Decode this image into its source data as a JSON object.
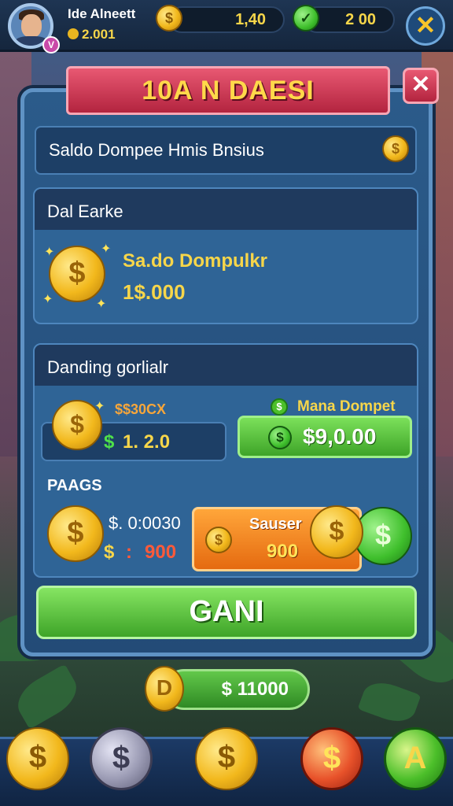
{
  "topbar": {
    "player_name": "Ide Alneett",
    "player_balance": "2.001",
    "currency_1_value": "1,40",
    "currency_2_value": "2 00",
    "currency_1_icon": "$",
    "currency_2_icon": "✓",
    "avatar_badge": "V",
    "close_glyph": "✕"
  },
  "dialog": {
    "title": "10A N DAESI",
    "close_glyph": "✕",
    "header_bar_text": "Saldo Dompee Hmis Bnsius",
    "header_bar_icon": "$"
  },
  "balance_section": {
    "heading": "Dal Earke",
    "label": "Sa.do Dompulkr",
    "amount": "1$.000",
    "coin_symbol": "$"
  },
  "trade_section": {
    "heading": "Danding gorlialr",
    "coin_symbol": "$",
    "small_label": "$$30CX",
    "field_prefix": "$",
    "field_value": "1. 2.0",
    "main_label": "Mana Dompet",
    "main_icon": "$",
    "main_value": "$9,0.00",
    "pages_label": "PAAGS",
    "row_value": "$. 0:0030",
    "row_prefix": "$",
    "row_sep": ":",
    "row_amount": "900",
    "orange_btn_label": "Sauser",
    "orange_btn_value": "900",
    "orange_coin": "$",
    "stack_coin_1": "$",
    "stack_coin_2": "$"
  },
  "action_button": "GANI",
  "bottom": {
    "pill_value": "$ 11000",
    "pill_coin": "D",
    "nav": [
      "$",
      "$",
      "$",
      "$",
      "A"
    ]
  }
}
